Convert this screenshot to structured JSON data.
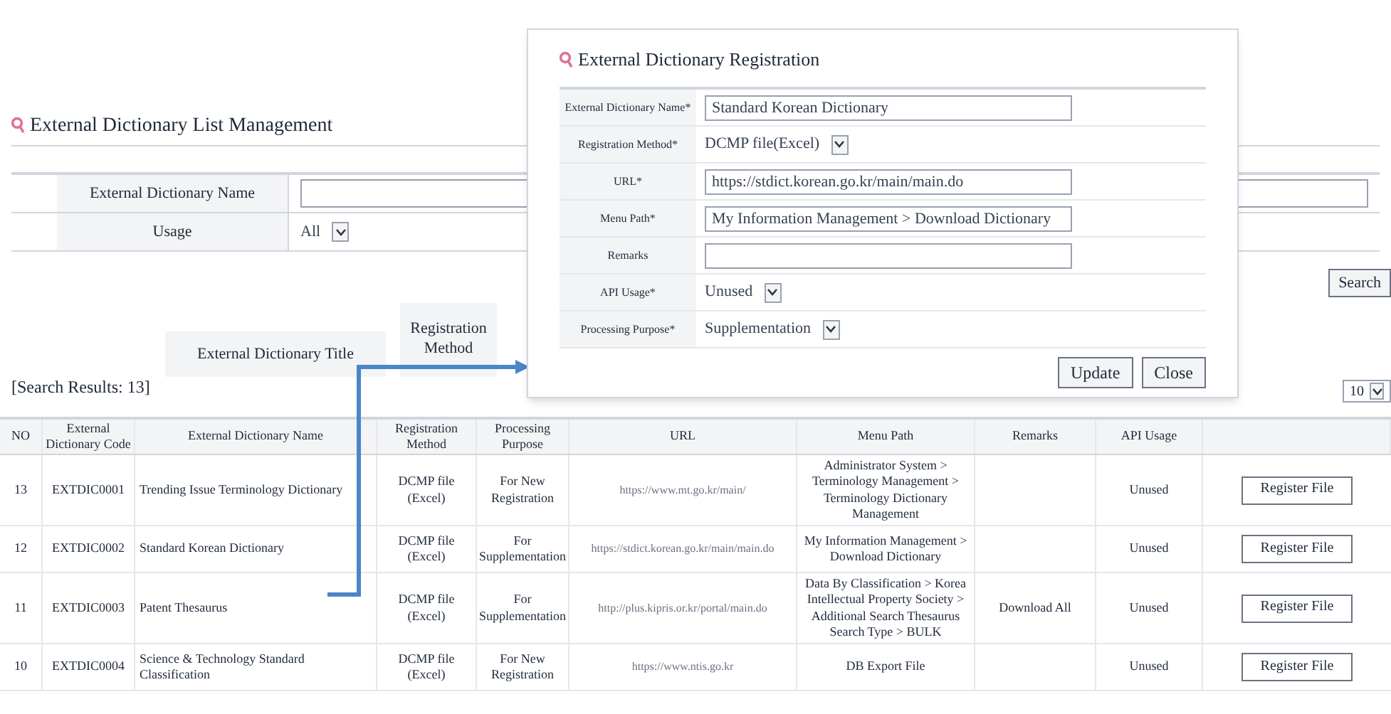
{
  "page": {
    "title": "External Dictionary List Management"
  },
  "search_form": {
    "fields": [
      {
        "kind": "input",
        "label": "External Dictionary Name"
      },
      {
        "kind": "select",
        "label": "Usage",
        "value": "All"
      }
    ],
    "search_button": "Search"
  },
  "column_labels": [
    "External Dictionary Title",
    "Registration Method"
  ],
  "results_count": "[Search Results: 13]",
  "page_size": "10",
  "table": {
    "columns": [
      "NO",
      "External Dictionary Code",
      "External Dictionary Name",
      "Registration Method",
      "Processing Purpose",
      "URL",
      "Menu Path",
      "Remarks",
      "API Usage",
      ""
    ],
    "rows": [
      {
        "no": "13",
        "code": "EXTDIC0001",
        "name": "Trending Issue Terminology Dictionary",
        "method": "DCMP file (Excel)",
        "purpose": "For New Registration",
        "url": "https://www.mt.go.kr/main/",
        "menu_path": "Administrator System > Terminology Management > Terminology Dictionary Management",
        "api_usage": "Unused",
        "button": "Register File"
      },
      {
        "no": "12",
        "code": "EXTDIC0002",
        "name": "Standard Korean Dictionary",
        "method": "DCMP file (Excel)",
        "purpose": "For Supplementation",
        "url": "https://stdict.korean.go.kr/main/main.do",
        "menu_path": "My Information Management > Download Dictionary",
        "api_usage": "Unused",
        "button": "Register File"
      },
      {
        "no": "11",
        "code": "EXTDIC0003",
        "name": "Patent Thesaurus",
        "method": "DCMP file (Excel)",
        "purpose": "For Supplementation",
        "url": "http://plus.kipris.or.kr/portal/main.do",
        "menu_path": "Data By Classification > Korea Intellectual Property Society > Additional Search Thesaurus Search Type > BULK",
        "remarks": "Download All",
        "api_usage": "Unused",
        "button": "Register File"
      },
      {
        "no": "10",
        "code": "EXTDIC0004",
        "name": "Science & Technology Standard Classification",
        "method": "DCMP file (Excel)",
        "purpose": "For New Registration",
        "url": "https://www.ntis.go.kr",
        "menu_path": "DB Export File",
        "api_usage": "Unused",
        "button": "Register File"
      }
    ]
  },
  "dialog": {
    "title": "External Dictionary Registration",
    "fields": [
      {
        "kind": "input",
        "label": "External Dictionary Name*",
        "value": "Standard Korean Dictionary"
      },
      {
        "kind": "select",
        "label": "Registration Method*",
        "value": "DCMP file(Excel)"
      },
      {
        "kind": "input",
        "label": "URL*",
        "value": "https://stdict.korean.go.kr/main/main.do"
      },
      {
        "kind": "input",
        "label": "Menu Path*",
        "value": "My Information Management > Download Dictionary"
      },
      {
        "kind": "input",
        "label": "Remarks"
      },
      {
        "kind": "select",
        "label": "API Usage*",
        "value": "Unused"
      },
      {
        "kind": "select",
        "label": "Processing Purpose*",
        "value": "Supplementation"
      }
    ],
    "buttons": [
      "Update",
      "Close"
    ]
  }
}
